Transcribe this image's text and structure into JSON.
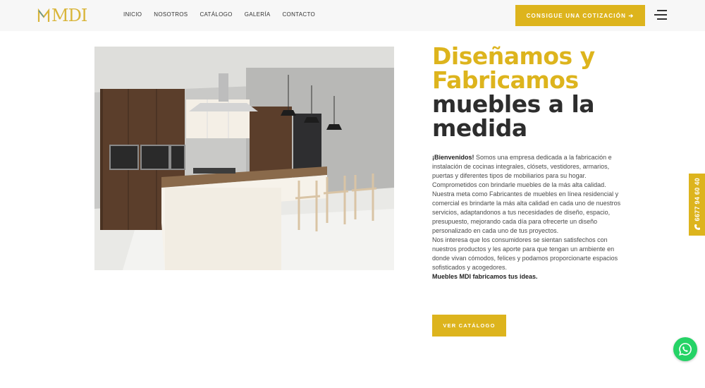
{
  "brand": {
    "logo_text": "MDI",
    "logo_color": "#d9b53a"
  },
  "nav": {
    "items": [
      {
        "label": "INICIO"
      },
      {
        "label": "NOSOTROS"
      },
      {
        "label": "CATÁLOGO"
      },
      {
        "label": "GALERÍA"
      },
      {
        "label": "CONTACTO"
      }
    ]
  },
  "header": {
    "quote_button_label": "CONSIGUE UNA COTIZACIÓN ➔",
    "menu_icon": "hamburger-icon"
  },
  "hero": {
    "image_icon": "kitchen-photo"
  },
  "heading": {
    "gold_line1": "Diseñamos y",
    "gold_line2": "Fabricamos",
    "dark_line1": "muebles a la",
    "dark_line2": "medida"
  },
  "intro": {
    "welcome_bold": "¡Bienvenidos!",
    "p1": " Somos una empresa dedicada a la fabricación e instalación de cocinas integrales, clósets, vestidores, armarios, puertas y diferentes tipos de mobiliarios para su hogar. Comprometidos con brindarle muebles de la más alta calidad.",
    "p2": "Nuestra meta como Fabricantes de muebles en línea residencial y comercial es brindarte la más alta calidad en cada uno de nuestros servicios, adaptandonos a tus necesidades de diseño, espacio, presupuesto, mejorando cada día para ofrecerte un diseño personalizado en cada uno de tus proyectos.",
    "p3": "Nos interesa que los consumidores se sientan satisfechos con nuestros productos y les aporte para que tengan un ambiente en donde vivan cómodos, felices y podamos proporcionarte espacios sofisticados y acogedores.",
    "tagline_bold": "Muebles MDI fabricamos tus ideas."
  },
  "catalog_button_label": "VER CATÁLOGO",
  "phone": {
    "number": "6677 94 60 40",
    "icon": "phone-icon"
  },
  "whatsapp": {
    "icon": "whatsapp-icon"
  },
  "colors": {
    "accent": "#ddb41d",
    "dark_text": "#2d2d2d",
    "whatsapp": "#25d366"
  }
}
